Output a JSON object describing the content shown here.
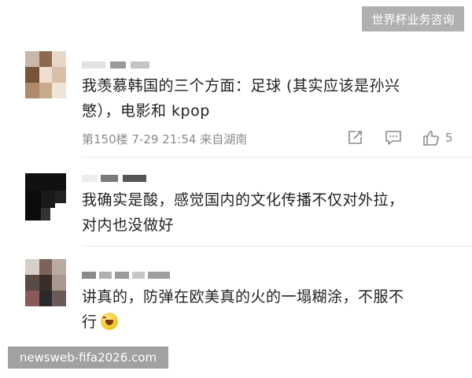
{
  "watermark_top": "世界杯业务咨询",
  "watermark_bottom": "newsweb-fifa2026.com",
  "comments": [
    {
      "text_line1": "我羡慕韩国的三个方面：足球 (其实应该是孙兴",
      "text_line2": "慜），电影和 kpop",
      "meta": "第150楼  7-29 21:54  来自湖南",
      "actions": {
        "share_icon": "share-icon",
        "comment_icon": "comment-icon",
        "like_icon": "thumbs-up-icon",
        "like_count": "5"
      }
    },
    {
      "text_line1": "我确实是酸，感觉国内的文化传播不仅对外拉，",
      "text_line2": "对内也没做好"
    },
    {
      "text_line1": "讲真的，防弹在欧美真的火的一塌糊涂，不服不",
      "text_line2": "行",
      "emoji": "laughing-crying-emoji"
    }
  ]
}
